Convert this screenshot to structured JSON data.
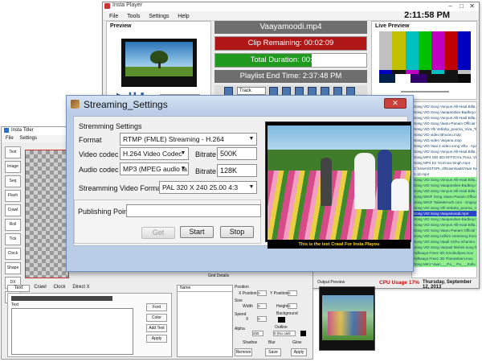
{
  "player": {
    "title": "Insta Player",
    "menu": [
      "File",
      "Tools",
      "Settings",
      "Help"
    ],
    "clock": "2:11:58 PM",
    "preview_label": "Preview",
    "live_preview_label": "Live Preview",
    "now_playing": "Vaayamoodi.mp4",
    "clip_remaining": "Clip Remaining: 00:02:09",
    "total_duration": "Total Duration: 00:24:09",
    "playlist_end": "Playlist End Time: 2:37:48 PM",
    "track_label": "Track",
    "playlist_items": [
      "Song VID Song Vonyun Alli-Hadi Billa Allaudi Pi",
      "Song VID Song Vaiapandian-Badboy.mkv",
      "Song VID Song Vonyun Alli-Hadi Billa Allaudi Pi",
      "Song VID Song Vaaru-Panam Official Video So",
      "Song VID Vlli Vettaha_poorna_Viva_Tin",
      "Song VID video Bhoovu.m2p",
      "Song VID video Vaiyana.m2p",
      "Song VID Vaai 2 video song Villu - Ayane - Ringo",
      "Song VID Song Vonyun Alli-Hadi Billa Allaudi Pi",
      "Song MP4 SDI 3DI EFFICIAL FULL VIDEO",
      "Song MP4 En Ya Enna Singh.mp4",
      "C:\\Users\\STSPL-2\\Downloads\\Yaar Ketha Naa",
      "1.12.mp4",
      "Song VID Song Vonyun Alli-Hadi Billa Allaudi Pi",
      "Song VID Song Vaiapandian-Badboy.mkv",
      "Song VID Song Vonyun Alli-Hadi Billa Allaudi Pi",
      "Song WKIF Song Vaaru-Panam Official Video So",
      "Song WKIF TakeMeAuth.com - Engeyum Kaadhal",
      "Song VID Song Vlli Vettaha_poorna_Viva_Tin",
      "Song VID Song Vaayamoodi.mp4",
      "Song VID Song Vaiapandian-Badboy.mkv",
      "Song VID Song Vonyun Alli-Hadi Billa Allaudi Pi",
      "Song VID Song Vaaru-Panam Official Video So",
      "Song VID Song Udhim Ureeriong from Tiraanthi",
      "Song VID Song Vaadi Vichu-Ichumiru Kothu from",
      "Song VID Song Vaaradi Mohini-song from Fmir",
      "Adhaaya Freez 3D Amoikullyee.mov",
      "Adhaaya Freez 3D Tharamkani.mov",
      "Song MKV Vaan___Pa__ Pa___Kollu Nmar"
    ],
    "cpu_usage": "CPU Usage 17%",
    "date": "Thursday, September 12, 2013"
  },
  "titler": {
    "title": "Insta Titler",
    "menu": [
      "File",
      "Settings"
    ],
    "side_tools": [
      "Text",
      "Image",
      "Seq",
      "Flash",
      "Crawl",
      "Roll",
      "Tick",
      "Clock",
      "Shape",
      "DX",
      "Mp3"
    ],
    "tabs": [
      "Text",
      "Crawl",
      "Clock",
      "Direct X"
    ],
    "text_label": "Text",
    "text_buttons": [
      "Font",
      "Color",
      "Add Text",
      "Apply"
    ],
    "name_header": "Name",
    "grid_details": "Grid Details",
    "position_label": "Position",
    "x_position_label": "X Position",
    "y_position_label": "Y Position",
    "x_value": "0",
    "y_value": "0",
    "size_label": "Size",
    "width_label": "Width",
    "height_label": "Height",
    "width_value": "0",
    "height_value": "0",
    "speed_label": "Speed",
    "speed_value": "0",
    "background_label": "Background",
    "alpha_label": "Alpha",
    "alpha_value": "255",
    "outline_label": "Outline",
    "outline_value": "0 (No outli",
    "effects": [
      "Shadow",
      "Blur",
      "Glow"
    ],
    "bottom_buttons": [
      "Remove",
      "Save",
      "Apply"
    ],
    "output_preview_label": "Output Preview"
  },
  "dialog": {
    "title": "Streaming_Settings",
    "group_label": "Stremming Settings",
    "format_label": "Format",
    "format_value": "RTMP (FMLE) Streaming - H.264",
    "video_codec_label": "Video codec",
    "video_codec_value": "H.264 Video Codec",
    "audio_codec_label": "Audio codec",
    "audio_codec_value": "MP3 (MPEG audio la",
    "bitrate_label": "Bitrate",
    "video_bitrate": "500K",
    "audio_bitrate": "128K",
    "video_format_label": "Streamming Video Format",
    "video_format_value": "PAL 320 X 240 25.00 4:3",
    "publishing_point_label": "Publishing Point",
    "publishing_point_value": "",
    "get_label": "Get",
    "start_label": "Start",
    "stop_label": "Stop",
    "crawl_text": "This is the test Crawl For Insta Playou",
    "close_symbol": "✕"
  },
  "colors": {
    "clip_remaining_bar": "#b01616",
    "total_duration_bar": "#1f9a1f",
    "playlist_highlight": "#8ff08b",
    "dialog_frame": "#b9cde6",
    "crawl_text": "#ffd400"
  }
}
